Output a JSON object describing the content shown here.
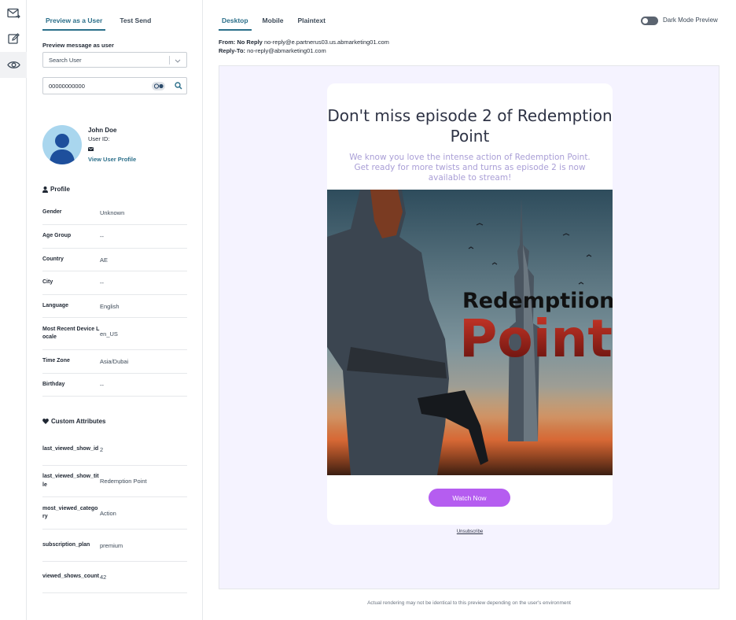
{
  "rail": {
    "items": [
      {
        "icon": "mail-send-icon"
      },
      {
        "icon": "edit-icon"
      },
      {
        "icon": "eye-icon"
      }
    ]
  },
  "left_tabs": [
    "Preview as a User",
    "Test Send"
  ],
  "preview": {
    "label": "Preview message as user",
    "search_placeholder": "Search User",
    "user_id_value": "00000000000"
  },
  "user": {
    "name": "John Doe",
    "id_label": "User ID:",
    "link": "View User Profile"
  },
  "profile": {
    "title": "Profile",
    "rows": [
      {
        "k": "Gender",
        "v": "Unknown"
      },
      {
        "k": "Age Group",
        "v": "--"
      },
      {
        "k": "Country",
        "v": "AE"
      },
      {
        "k": "City",
        "v": "--"
      },
      {
        "k": "Language",
        "v": "English"
      },
      {
        "k": "Most Recent Device Locale",
        "v": "en_US"
      },
      {
        "k": "Time Zone",
        "v": "Asia/Dubai"
      },
      {
        "k": "Birthday",
        "v": "--"
      }
    ]
  },
  "custom": {
    "title": "Custom Attributes",
    "rows": [
      {
        "k": "last_viewed_show_id",
        "v": "2"
      },
      {
        "k": "last_viewed_show_title",
        "v": "Redemption Point"
      },
      {
        "k": "most_viewed_category",
        "v": "Action"
      },
      {
        "k": "subscription_plan",
        "v": "premium"
      },
      {
        "k": "viewed_shows_count",
        "v": "42"
      }
    ]
  },
  "right_tabs": [
    "Desktop",
    "Mobile",
    "Plaintext"
  ],
  "dark_mode_label": "Dark Mode Preview",
  "headers": {
    "from_label": "From:",
    "from_name": "No Reply",
    "from_email": "no-reply@e.partnerus03.us.abmarketing01.com",
    "reply_label": "Reply-To:",
    "reply_email": "no-reply@abmarketing01.com"
  },
  "email": {
    "headline": "Don't miss episode 2 of Redemption Point",
    "subtext": "We know you love the intense action of Redemption Point. Get ready for more twists and turns as episode 2 is now available to stream!",
    "poster_title_1": "Redemptiion",
    "poster_title_2": "Point",
    "cta": "Watch Now",
    "unsubscribe": "Unsubscribe",
    "accent": "#b55df0"
  },
  "disclaimer": "Actual rendering may not be identical to this preview depending on the user's environment"
}
